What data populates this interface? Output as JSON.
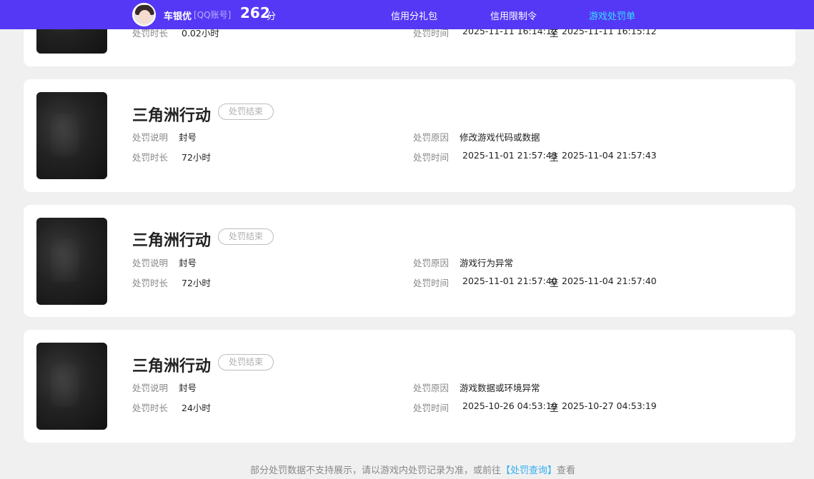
{
  "header": {
    "user_name": "车银优",
    "account_type": "[QQ账号]",
    "score": "262",
    "score_unit": "分",
    "tabs": [
      {
        "label": "信用分礼包",
        "active": false
      },
      {
        "label": "信用限制令",
        "active": false
      },
      {
        "label": "游戏处罚单",
        "active": true
      }
    ],
    "colors": {
      "bar": "#5538f5",
      "active_tab": "#35e0ff"
    }
  },
  "labels": {
    "penalty_desc": "处罚说明",
    "penalty_duration": "处罚时长",
    "penalty_reason": "处罚原因",
    "penalty_time": "处罚时间"
  },
  "records": [
    {
      "game": "",
      "status": "",
      "description": "",
      "reason": "",
      "duration": "0.02小时",
      "start": "2025-11-11 16:14:12",
      "to": "至",
      "end": "2025-11-11 16:15:12"
    },
    {
      "game": "三角洲行动",
      "status": "处罚结束",
      "description": "封号",
      "reason": "修改游戏代码或数据",
      "duration": "72小时",
      "start": "2025-11-01 21:57:43",
      "to": "至",
      "end": "2025-11-04 21:57:43"
    },
    {
      "game": "三角洲行动",
      "status": "处罚结束",
      "description": "封号",
      "reason": "游戏行为异常",
      "duration": "72小时",
      "start": "2025-11-01 21:57:40",
      "to": "至",
      "end": "2025-11-04 21:57:40"
    },
    {
      "game": "三角洲行动",
      "status": "处罚结束",
      "description": "封号",
      "reason": "游戏数据或环境异常",
      "duration": "24小时",
      "start": "2025-10-26 04:53:19",
      "to": "至",
      "end": "2025-10-27 04:53:19"
    }
  ],
  "footer": {
    "note_prefix": "部分处罚数据不支持展示，请以游戏内处罚记录为准，或前往",
    "link": "【处罚查询】",
    "note_suffix": "查看"
  }
}
